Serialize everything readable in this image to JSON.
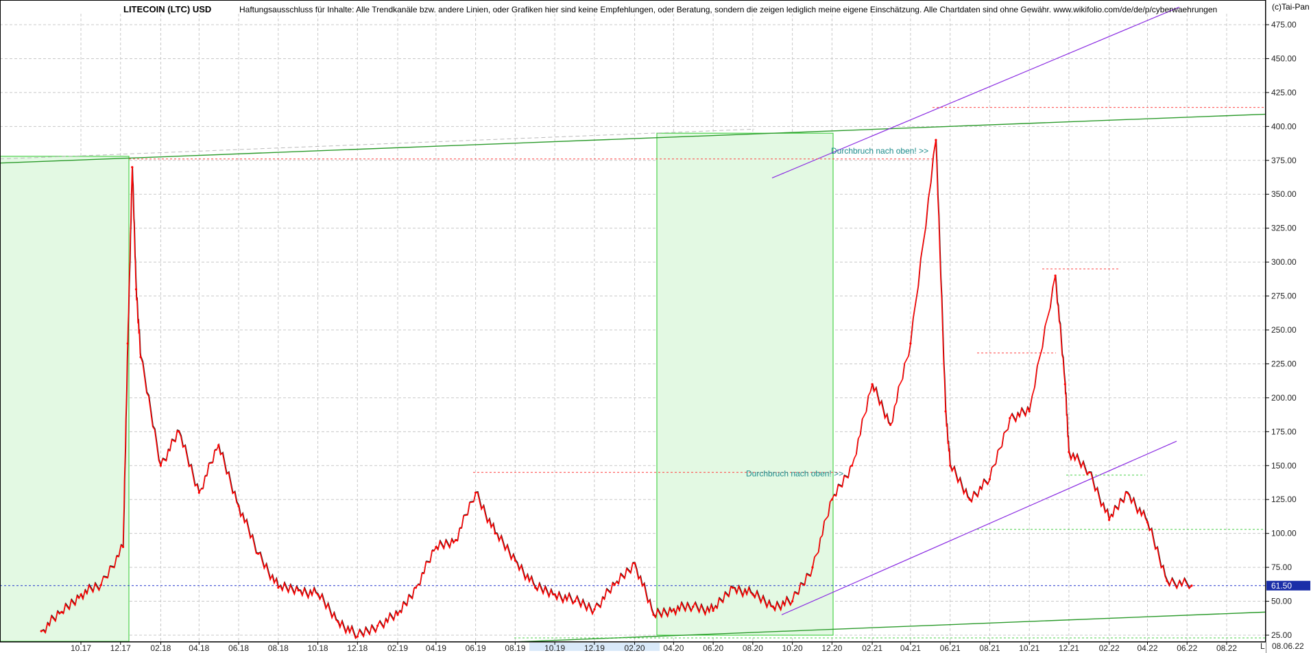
{
  "chart_data": {
    "type": "line",
    "title": "LITECOIN (LTC) USD",
    "disclaimer": "Haftungsausschluss für Inhalte: Alle Trendkanäle bzw. andere Linien, oder Grafiken hier sind keine Empfehlungen, oder Beratung, sondern die zeigen lediglich meine eigene Einschätzung. Alle Chartdaten sind ohne Gewähr.  www.wikifolio.com/de/de/p/cyberwaehrungen",
    "copyright": "(c)Tai-Pan",
    "current_price_label": "61.50",
    "current_price": 61.5,
    "date_label": "08.06.22",
    "ylim": [
      20,
      490
    ],
    "y_ticks": [
      "25.00",
      "50.00",
      "75.00",
      "100.00",
      "125.00",
      "150.00",
      "175.00",
      "200.00",
      "225.00",
      "250.00",
      "275.00",
      "300.00",
      "325.00",
      "350.00",
      "375.00",
      "400.00",
      "425.00",
      "450.00",
      "475.00"
    ],
    "x_ticks": [
      "10.17",
      "12.17",
      "02.18",
      "04.18",
      "06.18",
      "08.18",
      "10.18",
      "12.18",
      "02.19",
      "04.19",
      "06.19",
      "08.19",
      "10.19",
      "12.19",
      "02.20",
      "04.20",
      "06.20",
      "08.20",
      "10.20",
      "12.20",
      "02.21",
      "04.21",
      "06.21",
      "08.21",
      "10.21",
      "12.21",
      "02.22",
      "04.22",
      "06.22",
      "08.22"
    ],
    "annotations": [
      "Durchbruch nach oben! >>",
      "Durchbruch nach oben! >>"
    ],
    "series": [
      {
        "color": "#ff0000",
        "x": [
          "2017-08",
          "2017-09",
          "2017-10",
          "2017-11",
          "2017-12-05",
          "2017-12-12",
          "2017-12-19",
          "2017-12-25",
          "2018-01",
          "2018-02",
          "2018-03",
          "2018-04",
          "2018-05",
          "2018-06",
          "2018-07",
          "2018-08",
          "2018-09",
          "2018-10",
          "2018-11",
          "2018-12",
          "2019-01",
          "2019-02",
          "2019-03",
          "2019-04",
          "2019-05",
          "2019-06",
          "2019-07",
          "2019-08",
          "2019-09",
          "2019-10",
          "2019-11",
          "2019-12",
          "2020-01",
          "2020-02",
          "2020-03",
          "2020-04",
          "2020-05",
          "2020-06",
          "2020-07",
          "2020-08",
          "2020-09",
          "2020-10",
          "2020-11",
          "2020-12",
          "2021-01",
          "2021-02",
          "2021-03",
          "2021-04",
          "2021-05-10",
          "2021-05-25",
          "2021-06",
          "2021-07",
          "2021-08",
          "2021-09",
          "2021-10",
          "2021-11-10",
          "2021-11-25",
          "2021-12",
          "2022-01",
          "2022-02",
          "2022-03",
          "2022-04",
          "2022-05",
          "2022-06-08"
        ],
        "values": [
          28,
          42,
          55,
          62,
          90,
          240,
          370,
          280,
          230,
          150,
          175,
          130,
          165,
          120,
          85,
          60,
          58,
          55,
          35,
          24,
          32,
          40,
          60,
          90,
          95,
          130,
          100,
          80,
          60,
          55,
          50,
          44,
          62,
          78,
          40,
          44,
          46,
          43,
          60,
          55,
          46,
          50,
          75,
          125,
          150,
          210,
          180,
          240,
          390,
          190,
          150,
          125,
          140,
          185,
          190,
          290,
          210,
          160,
          145,
          110,
          130,
          108,
          65,
          61.5
        ]
      }
    ]
  }
}
